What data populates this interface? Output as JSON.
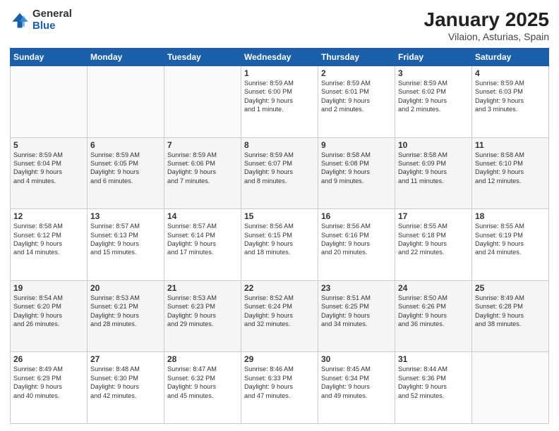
{
  "logo": {
    "general": "General",
    "blue": "Blue"
  },
  "title": "January 2025",
  "subtitle": "Vilaion, Asturias, Spain",
  "days_of_week": [
    "Sunday",
    "Monday",
    "Tuesday",
    "Wednesday",
    "Thursday",
    "Friday",
    "Saturday"
  ],
  "weeks": [
    [
      {
        "day": "",
        "content": ""
      },
      {
        "day": "",
        "content": ""
      },
      {
        "day": "",
        "content": ""
      },
      {
        "day": "1",
        "content": "Sunrise: 8:59 AM\nSunset: 6:00 PM\nDaylight: 9 hours\nand 1 minute."
      },
      {
        "day": "2",
        "content": "Sunrise: 8:59 AM\nSunset: 6:01 PM\nDaylight: 9 hours\nand 2 minutes."
      },
      {
        "day": "3",
        "content": "Sunrise: 8:59 AM\nSunset: 6:02 PM\nDaylight: 9 hours\nand 2 minutes."
      },
      {
        "day": "4",
        "content": "Sunrise: 8:59 AM\nSunset: 6:03 PM\nDaylight: 9 hours\nand 3 minutes."
      }
    ],
    [
      {
        "day": "5",
        "content": "Sunrise: 8:59 AM\nSunset: 6:04 PM\nDaylight: 9 hours\nand 4 minutes."
      },
      {
        "day": "6",
        "content": "Sunrise: 8:59 AM\nSunset: 6:05 PM\nDaylight: 9 hours\nand 6 minutes."
      },
      {
        "day": "7",
        "content": "Sunrise: 8:59 AM\nSunset: 6:06 PM\nDaylight: 9 hours\nand 7 minutes."
      },
      {
        "day": "8",
        "content": "Sunrise: 8:59 AM\nSunset: 6:07 PM\nDaylight: 9 hours\nand 8 minutes."
      },
      {
        "day": "9",
        "content": "Sunrise: 8:58 AM\nSunset: 6:08 PM\nDaylight: 9 hours\nand 9 minutes."
      },
      {
        "day": "10",
        "content": "Sunrise: 8:58 AM\nSunset: 6:09 PM\nDaylight: 9 hours\nand 11 minutes."
      },
      {
        "day": "11",
        "content": "Sunrise: 8:58 AM\nSunset: 6:10 PM\nDaylight: 9 hours\nand 12 minutes."
      }
    ],
    [
      {
        "day": "12",
        "content": "Sunrise: 8:58 AM\nSunset: 6:12 PM\nDaylight: 9 hours\nand 14 minutes."
      },
      {
        "day": "13",
        "content": "Sunrise: 8:57 AM\nSunset: 6:13 PM\nDaylight: 9 hours\nand 15 minutes."
      },
      {
        "day": "14",
        "content": "Sunrise: 8:57 AM\nSunset: 6:14 PM\nDaylight: 9 hours\nand 17 minutes."
      },
      {
        "day": "15",
        "content": "Sunrise: 8:56 AM\nSunset: 6:15 PM\nDaylight: 9 hours\nand 18 minutes."
      },
      {
        "day": "16",
        "content": "Sunrise: 8:56 AM\nSunset: 6:16 PM\nDaylight: 9 hours\nand 20 minutes."
      },
      {
        "day": "17",
        "content": "Sunrise: 8:55 AM\nSunset: 6:18 PM\nDaylight: 9 hours\nand 22 minutes."
      },
      {
        "day": "18",
        "content": "Sunrise: 8:55 AM\nSunset: 6:19 PM\nDaylight: 9 hours\nand 24 minutes."
      }
    ],
    [
      {
        "day": "19",
        "content": "Sunrise: 8:54 AM\nSunset: 6:20 PM\nDaylight: 9 hours\nand 26 minutes."
      },
      {
        "day": "20",
        "content": "Sunrise: 8:53 AM\nSunset: 6:21 PM\nDaylight: 9 hours\nand 28 minutes."
      },
      {
        "day": "21",
        "content": "Sunrise: 8:53 AM\nSunset: 6:23 PM\nDaylight: 9 hours\nand 29 minutes."
      },
      {
        "day": "22",
        "content": "Sunrise: 8:52 AM\nSunset: 6:24 PM\nDaylight: 9 hours\nand 32 minutes."
      },
      {
        "day": "23",
        "content": "Sunrise: 8:51 AM\nSunset: 6:25 PM\nDaylight: 9 hours\nand 34 minutes."
      },
      {
        "day": "24",
        "content": "Sunrise: 8:50 AM\nSunset: 6:26 PM\nDaylight: 9 hours\nand 36 minutes."
      },
      {
        "day": "25",
        "content": "Sunrise: 8:49 AM\nSunset: 6:28 PM\nDaylight: 9 hours\nand 38 minutes."
      }
    ],
    [
      {
        "day": "26",
        "content": "Sunrise: 8:49 AM\nSunset: 6:29 PM\nDaylight: 9 hours\nand 40 minutes."
      },
      {
        "day": "27",
        "content": "Sunrise: 8:48 AM\nSunset: 6:30 PM\nDaylight: 9 hours\nand 42 minutes."
      },
      {
        "day": "28",
        "content": "Sunrise: 8:47 AM\nSunset: 6:32 PM\nDaylight: 9 hours\nand 45 minutes."
      },
      {
        "day": "29",
        "content": "Sunrise: 8:46 AM\nSunset: 6:33 PM\nDaylight: 9 hours\nand 47 minutes."
      },
      {
        "day": "30",
        "content": "Sunrise: 8:45 AM\nSunset: 6:34 PM\nDaylight: 9 hours\nand 49 minutes."
      },
      {
        "day": "31",
        "content": "Sunrise: 8:44 AM\nSunset: 6:36 PM\nDaylight: 9 hours\nand 52 minutes."
      },
      {
        "day": "",
        "content": ""
      }
    ]
  ]
}
